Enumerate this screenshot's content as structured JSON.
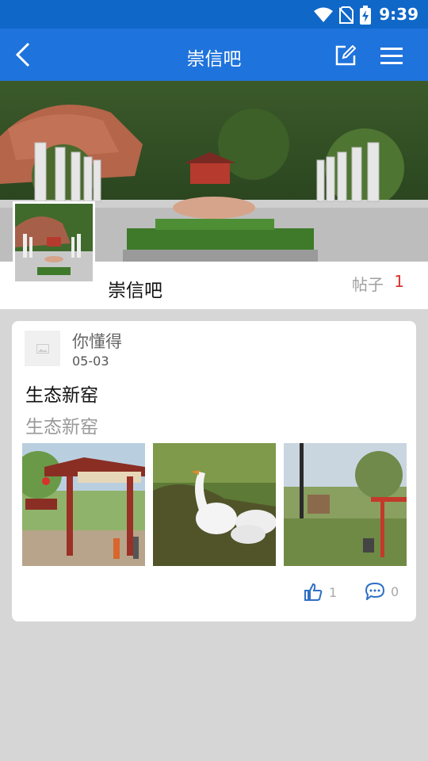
{
  "status": {
    "time": "9:39"
  },
  "appbar": {
    "title": "崇信吧"
  },
  "forum": {
    "name": "崇信吧",
    "posts_label": "帖子",
    "posts_count": "1"
  },
  "post": {
    "author": "你懂得",
    "date": "05-03",
    "title": "生态新窑",
    "summary": "生态新窑",
    "likes": "1",
    "comments": "0"
  },
  "colors": {
    "appbar": "#1f73dc",
    "statusbar": "#0f67c8",
    "accent_red": "#d8322d",
    "action_blue": "#2f6fc4"
  }
}
